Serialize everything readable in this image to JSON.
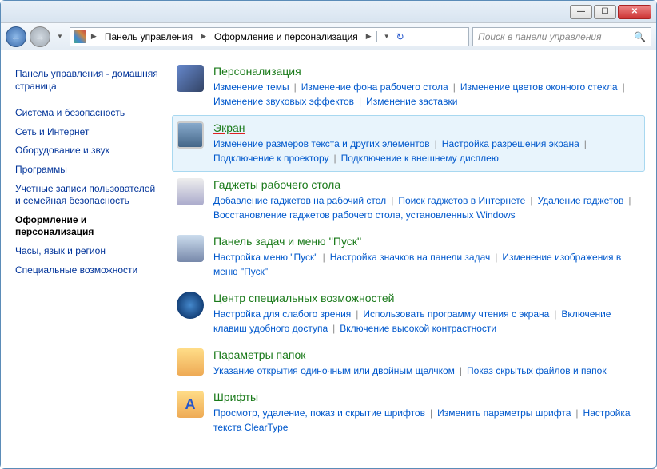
{
  "titlebar": {
    "min": "—",
    "max": "☐",
    "close": "✕"
  },
  "nav": {
    "back": "←",
    "forward": "→",
    "crumbs": [
      "Панель управления",
      "Оформление и персонализация"
    ],
    "search_placeholder": "Поиск в панели управления"
  },
  "sidebar": {
    "home": "Панель управления - домашняя страница",
    "items": [
      "Система и безопасность",
      "Сеть и Интернет",
      "Оборудование и звук",
      "Программы",
      "Учетные записи пользователей и семейная безопасность",
      "Оформление и персонализация",
      "Часы, язык и регион",
      "Специальные возможности"
    ],
    "active_index": 5
  },
  "categories": [
    {
      "id": "personalization",
      "icon": "ico-pers",
      "title": "Персонализация",
      "links": [
        "Изменение темы",
        "Изменение фона рабочего стола",
        "Изменение цветов оконного стекла",
        "Изменение звуковых эффектов",
        "Изменение заставки"
      ]
    },
    {
      "id": "display",
      "icon": "ico-disp",
      "selected": true,
      "underlined": true,
      "title": "Экран",
      "links": [
        "Изменение размеров текста и других элементов",
        "Настройка разрешения экрана",
        "Подключение к проектору",
        "Подключение к внешнему дисплею"
      ]
    },
    {
      "id": "gadgets",
      "icon": "ico-gadg",
      "title": "Гаджеты рабочего стола",
      "links": [
        "Добавление гаджетов на рабочий стол",
        "Поиск гаджетов в Интернете",
        "Удаление гаджетов",
        "Восстановление гаджетов рабочего стола, установленных Windows"
      ]
    },
    {
      "id": "taskbar",
      "icon": "ico-task",
      "title": "Панель задач и меню ''Пуск''",
      "links": [
        "Настройка меню \"Пуск\"",
        "Настройка значков на панели задач",
        "Изменение изображения в меню \"Пуск\""
      ]
    },
    {
      "id": "ease",
      "icon": "ico-ease",
      "title": "Центр специальных возможностей",
      "links": [
        "Настройка для слабого зрения",
        "Использовать программу чтения с экрана",
        "Включение клавиш удобного доступа",
        "Включение высокой контрастности"
      ]
    },
    {
      "id": "folders",
      "icon": "ico-fold",
      "title": "Параметры папок",
      "links": [
        "Указание открытия одиночным или двойным щелчком",
        "Показ скрытых файлов и папок"
      ]
    },
    {
      "id": "fonts",
      "icon": "ico-font",
      "glyph": "A",
      "title": "Шрифты",
      "links": [
        "Просмотр, удаление, показ и скрытие шрифтов",
        "Изменить параметры шрифта",
        "Настройка текста ClearType"
      ]
    }
  ]
}
